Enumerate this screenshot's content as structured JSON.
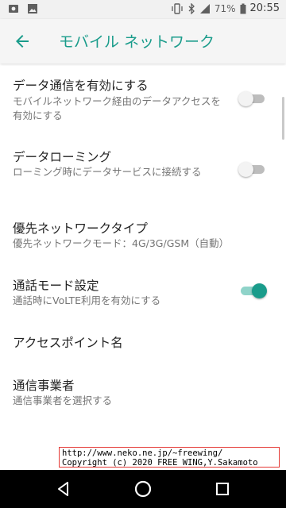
{
  "status_bar": {
    "battery": "71%",
    "time": "20:55"
  },
  "app_bar": {
    "title": "モバイル ネットワーク"
  },
  "settings": [
    {
      "title": "データ通信を有効にする",
      "subtitle": "モバイルネットワーク経由のデータアクセスを有効にする",
      "toggle": "off"
    },
    {
      "title": "データローミング",
      "subtitle": "ローミング時にデータサービスに接続する",
      "toggle": "off"
    },
    {
      "title": "優先ネットワークタイプ",
      "subtitle": "優先ネットワークモード：4G/3G/GSM（自動）"
    },
    {
      "title": "通話モード設定",
      "subtitle": "通話時にVoLTE利用を有効にする",
      "toggle": "on"
    },
    {
      "title": "アクセスポイント名"
    },
    {
      "title": "通信事業者",
      "subtitle": "通信事業者を選択する"
    }
  ],
  "watermark": {
    "line1": "http://www.neko.ne.jp/~freewing/",
    "line2": "Copyright (c) 2020 FREE WING,Y.Sakamoto"
  },
  "colors": {
    "accent": "#1a9c8b",
    "toggle_on_track": "#8fd3c9",
    "toggle_off_track": "#bdbdbd"
  },
  "icons": {
    "status_left": [
      "photo-icon",
      "gallery-icon"
    ],
    "status_right": [
      "vibrate-icon",
      "bluetooth-icon",
      "signal-icon",
      "battery-icon"
    ],
    "navbar": [
      "back-triangle-icon",
      "home-circle-icon",
      "recents-square-icon"
    ]
  }
}
